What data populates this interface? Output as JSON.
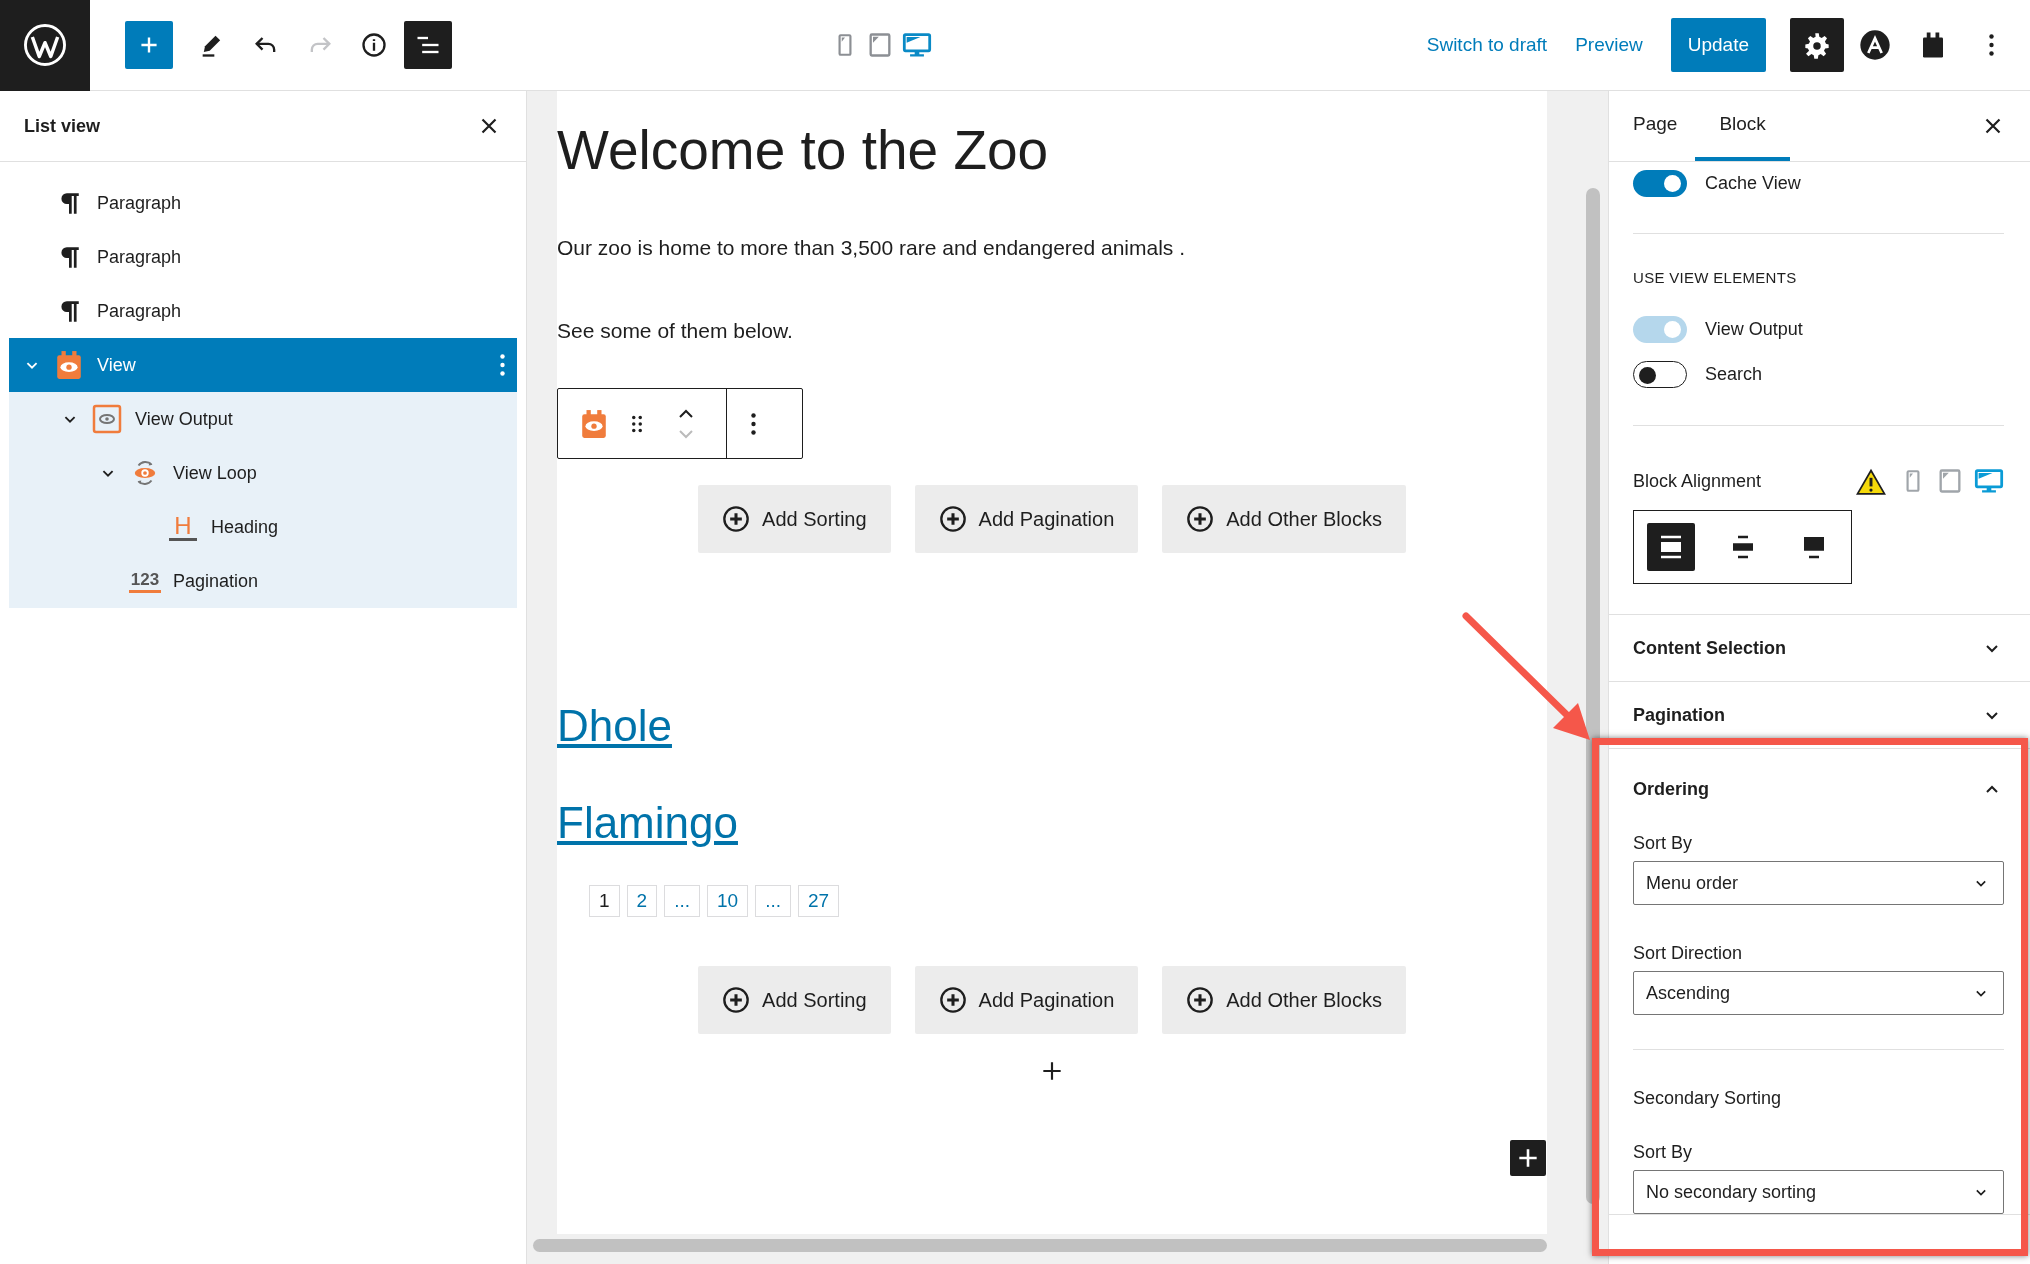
{
  "toolbar": {
    "tools": [
      {
        "kind": "inserter",
        "selected": false,
        "disabled": false
      },
      {
        "kind": "edit",
        "selected": false,
        "disabled": false
      },
      {
        "kind": "undo",
        "selected": false,
        "disabled": false
      },
      {
        "kind": "redo",
        "selected": false,
        "disabled": true
      },
      {
        "kind": "details",
        "selected": false,
        "disabled": false
      },
      {
        "kind": "list-view",
        "selected": true,
        "disabled": false
      }
    ],
    "devices": [
      {
        "kind": "mobile",
        "selected": false
      },
      {
        "kind": "tablet",
        "selected": false
      },
      {
        "kind": "desktop",
        "selected": true
      }
    ],
    "actions": [
      {
        "kind": "link",
        "label": "Switch to draft"
      },
      {
        "kind": "link",
        "label": "Preview"
      },
      {
        "kind": "primary",
        "label": "Update"
      }
    ],
    "extras": [
      {
        "kind": "settings",
        "selected": true
      },
      {
        "kind": "brand",
        "selected": false
      },
      {
        "kind": "plugin",
        "selected": false
      },
      {
        "kind": "more",
        "selected": false
      }
    ]
  },
  "list_view": {
    "title": "List view",
    "items": [
      {
        "label": "Paragraph",
        "kind": "paragraph",
        "selected": false
      },
      {
        "label": "Paragraph",
        "kind": "paragraph",
        "selected": false
      },
      {
        "label": "Paragraph",
        "kind": "paragraph",
        "selected": false
      },
      {
        "label": "View",
        "kind": "view",
        "selected": true,
        "expanded": true,
        "children": [
          {
            "label": "View Output",
            "kind": "view-output",
            "selected": false,
            "expanded": true,
            "children": [
              {
                "label": "View Loop",
                "kind": "view-loop",
                "selected": false,
                "expanded": true,
                "children": [
                  {
                    "label": "Heading",
                    "kind": "heading",
                    "icon_text": "H",
                    "selected": false
                  }
                ]
              },
              {
                "label": "Pagination",
                "kind": "pagination",
                "icon_text": "123",
                "selected": false
              }
            ]
          }
        ]
      }
    ]
  },
  "editor": {
    "title": "Welcome to the Zoo",
    "paragraphs": [
      "Our zoo is home to more than 3,500 rare and endangered animals .",
      "See some of them below."
    ],
    "button_rows": [
      [
        "Add Sorting",
        "Add Pagination",
        "Add Other Blocks"
      ],
      [
        "Add Sorting",
        "Add Pagination",
        "Add Other Blocks"
      ]
    ],
    "posts": [
      "Dhole",
      "Flamingo"
    ],
    "pagination": [
      {
        "label": "1",
        "selected": true
      },
      {
        "label": "2",
        "selected": false
      },
      {
        "label": "...",
        "selected": false
      },
      {
        "label": "10",
        "selected": false
      },
      {
        "label": "...",
        "selected": false
      },
      {
        "label": "27",
        "selected": false
      }
    ]
  },
  "sidebar": {
    "tabs": [
      {
        "label": "Page",
        "selected": false
      },
      {
        "label": "Block",
        "selected": true
      }
    ],
    "cache": {
      "label": "Cache View",
      "on": true,
      "disabled": false
    },
    "elements_title": "USE VIEW ELEMENTS",
    "elements": [
      {
        "label": "View Output",
        "on": true,
        "disabled": true
      },
      {
        "label": "Search",
        "on": false,
        "disabled": false
      }
    ],
    "alignment": {
      "label": "Block Alignment",
      "warning": true,
      "devices": [
        {
          "kind": "mobile",
          "selected": false
        },
        {
          "kind": "tablet",
          "selected": false
        },
        {
          "kind": "desktop",
          "selected": true
        }
      ],
      "options": [
        {
          "kind": "full",
          "selected": true
        },
        {
          "kind": "wide",
          "selected": false
        },
        {
          "kind": "none",
          "selected": false
        }
      ]
    },
    "panels": [
      {
        "title": "Content Selection",
        "expanded": false,
        "highlighted": false
      },
      {
        "title": "Pagination",
        "expanded": false,
        "highlighted": false
      },
      {
        "title": "Ordering",
        "expanded": true,
        "highlighted": true,
        "fields": [
          {
            "label": "Sort By",
            "value": "Menu order"
          },
          {
            "label": "Sort Direction",
            "value": "Ascending"
          }
        ],
        "secondary": {
          "title": "Secondary Sorting",
          "fields": [
            {
              "label": "Sort By",
              "value": "No secondary sorting"
            }
          ]
        }
      }
    ]
  }
}
